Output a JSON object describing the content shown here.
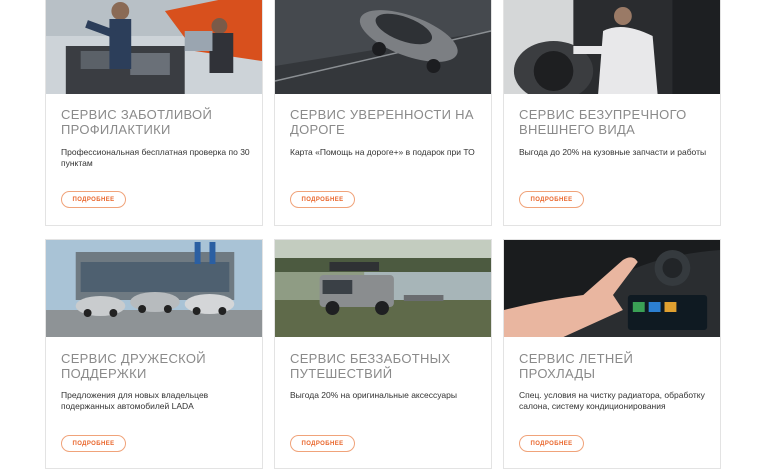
{
  "cards": [
    {
      "title": "СЕРВИС ЗАБОТЛИВОЙ ПРОФИЛАКТИКИ",
      "desc": "Профессиональная бесплатная проверка по 30 пунктам",
      "button": "ПОДРОБНЕЕ",
      "image": "mechanic-engine-photo"
    },
    {
      "title": "СЕРВИС УВЕРЕННОСТИ НА ДОРОГЕ",
      "desc": "Карта «Помощь на дороге+» в подарок при ТО",
      "button": "ПОДРОБНЕЕ",
      "image": "car-on-road-photo"
    },
    {
      "title": "СЕРВИС БЕЗУПРЕЧНОГО ВНЕШНЕГО ВИДА",
      "desc": "Выгода до 20% на кузовные запчасти и работы",
      "button": "ПОДРОБНЕЕ",
      "image": "man-inspecting-car-photo"
    },
    {
      "title": "СЕРВИС ДРУЖЕСКОЙ ПОДДЕРЖКИ",
      "desc": "Предложения для новых владельцев подержанных автомобилей LADA",
      "button": "ПОДРОБНЕЕ",
      "image": "dealership-cars-photo"
    },
    {
      "title": "СЕРВИС БЕЗЗАБОТНЫХ ПУТЕШЕСТВИЙ",
      "desc": "Выгода 20% на оригинальные аксессуары",
      "button": "ПОДРОБНЕЕ",
      "image": "suv-by-lake-photo"
    },
    {
      "title": "СЕРВИС ЛЕТНЕЙ ПРОХЛАДЫ",
      "desc": "Спец. условия на чистку радиатора, обработку салона, систему кондиционирования",
      "button": "ПОДРОБНЕЕ",
      "image": "hand-air-vent-photo"
    }
  ],
  "colors": {
    "accent": "#e9652a",
    "title": "#8a8a8a",
    "border": "#e3e3e3"
  }
}
